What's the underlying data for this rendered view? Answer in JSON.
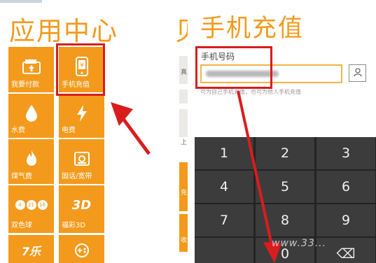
{
  "left": {
    "title": "应用中心",
    "tiles": [
      {
        "label": "我要付款",
        "icon": "wallet-icon"
      },
      {
        "label": "手机充值",
        "icon": "phone-recharge-icon"
      },
      {
        "label": "水费",
        "icon": "water-drop-icon"
      },
      {
        "label": "电费",
        "icon": "lightning-icon"
      },
      {
        "label": "煤气费",
        "icon": "flame-icon"
      },
      {
        "label": "固话/宽带",
        "icon": "landline-icon"
      },
      {
        "label": "双色球",
        "icon": "lottery-balls-icon",
        "balls": [
          "4",
          "21",
          "16"
        ]
      },
      {
        "label": "福彩3D",
        "icon": "lottery-3d-icon",
        "badge": "3D"
      },
      {
        "label": "",
        "icon": "seven-lottery-icon",
        "badge": "7乐"
      },
      {
        "label": "",
        "icon": "game-controller-icon"
      }
    ]
  },
  "middle": {
    "title_fragment": "贝",
    "fragments": [
      "真",
      "上",
      "充",
      "收"
    ]
  },
  "right": {
    "title": "手机充值",
    "phone_label": "手机号码",
    "phone_value": "",
    "hint": "可为自己手机充值，也可为他人手机充值",
    "keypad": [
      "1",
      "2",
      "3",
      "4",
      "5",
      "6",
      "7",
      "8",
      "9",
      "",
      "0",
      "⌫"
    ]
  },
  "colors": {
    "accent": "#f39a1c",
    "highlight": "#d91d1d",
    "keypad_bg": "#232323",
    "key_bg": "#3c3c3c"
  },
  "watermark": "www.33..."
}
